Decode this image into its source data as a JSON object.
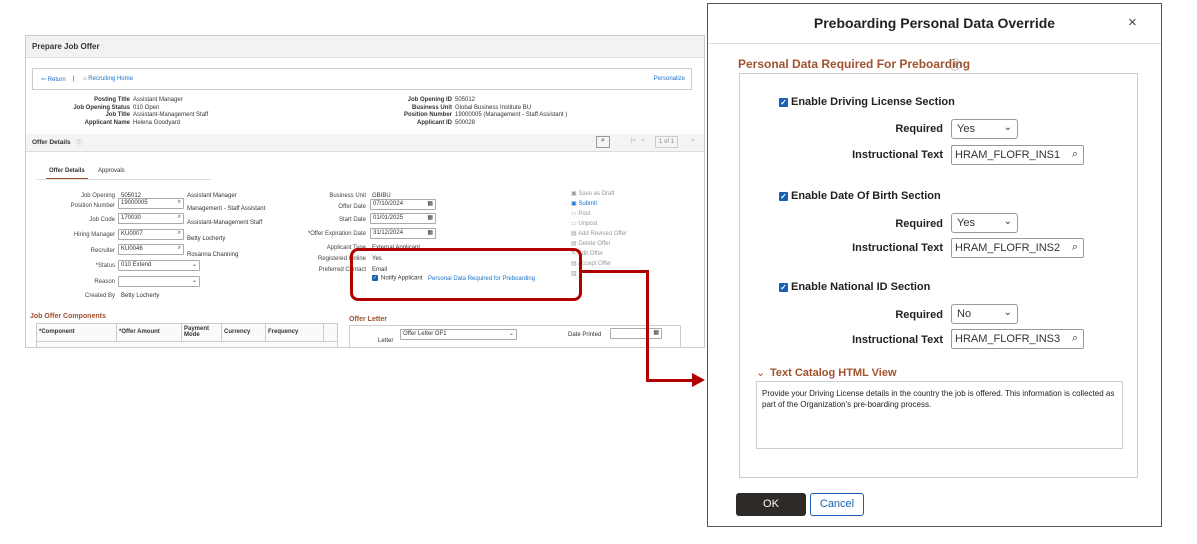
{
  "left": {
    "title": "Prepare Job Offer",
    "nav": {
      "return": "Return",
      "home": "Recruiting Home",
      "personalize": "Personalize"
    },
    "header": [
      {
        "label": "Posting Title",
        "value": "Assistant Manager"
      },
      {
        "label": "Job Opening Status",
        "value": "010 Open"
      },
      {
        "label": "Job Title",
        "value": "Assistant-Management Staff"
      },
      {
        "label": "Applicant Name",
        "value": "Helena Goodyard"
      }
    ],
    "header_right": [
      {
        "label": "Job Opening ID",
        "value": "505012"
      },
      {
        "label": "Business Unit",
        "value": "Global Business Institute BU"
      },
      {
        "label": "Position Number",
        "value": "19000005 (Management - Staff Assistant )"
      },
      {
        "label": "Applicant ID",
        "value": "500028"
      }
    ],
    "offer_details": "Offer Details",
    "pager": "1 of 1",
    "tabs": [
      "Offer Details",
      "Approvals"
    ],
    "form": {
      "job_opening": {
        "label": "Job Opening",
        "value": "505012",
        "desc": "Assistant Manager"
      },
      "position_number": {
        "label": "Position Number",
        "value": "19000005",
        "desc": "Management - Staff Assistant"
      },
      "job_code": {
        "label": "Job Code",
        "value": "170030",
        "desc": "Assistant-Management Staff"
      },
      "hiring_manager": {
        "label": "Hiring Manager",
        "value": "KU0007",
        "desc": "Betty Locherty"
      },
      "recruiter": {
        "label": "Recruiter",
        "value": "KU0046",
        "desc": "Rosanna Channing"
      },
      "status": {
        "label": "*Status",
        "value": "010 Extend"
      },
      "reason": {
        "label": "Reason",
        "value": ""
      },
      "created_by": {
        "label": "Created By",
        "value": "Betty Locherty"
      }
    },
    "form2": {
      "business_unit": {
        "label": "Business Unit",
        "value": "GBIBU"
      },
      "offer_date": {
        "label": "Offer Date",
        "value": "07/10/2024"
      },
      "start_date": {
        "label": "Start Date",
        "value": "01/01/2025"
      },
      "expiration": {
        "label": "*Offer Expiration Date",
        "value": "31/12/2024"
      },
      "applicant_type": {
        "label": "Applicant Type",
        "value": "External Applicant"
      },
      "registered": {
        "label": "Registered Online",
        "value": "Yes"
      },
      "contact": {
        "label": "Preferred Contact",
        "value": "Email"
      },
      "notify": "Notify Applicant",
      "preboarding_link": "Personal Data Required for Preboarding"
    },
    "actions": [
      "Save as Draft",
      "Submit",
      "Post",
      "Unpost",
      "Add Revised Offer",
      "Delete Offer",
      "Edit Offer",
      "Accept Offer"
    ],
    "components": {
      "title": "Job Offer Components",
      "columns": [
        "*Component",
        "*Offer Amount",
        "Payment Mode",
        "Currency",
        "Frequency"
      ]
    },
    "letter": {
      "title": "Offer Letter",
      "label": "Letter",
      "value": "Offer Letter OF1",
      "date_printed": "Date Printed"
    }
  },
  "dialog": {
    "title": "Preboarding Personal Data Override",
    "section": "Personal Data Required For Preboarding",
    "groups": [
      {
        "enable": "Enable Driving License Section",
        "required_label": "Required",
        "required": "Yes",
        "text_label": "Instructional Text",
        "text": "HRAM_FLOFR_INS1"
      },
      {
        "enable": "Enable Date Of Birth Section",
        "required_label": "Required",
        "required": "Yes",
        "text_label": "Instructional Text",
        "text": "HRAM_FLOFR_INS2"
      },
      {
        "enable": "Enable National ID Section",
        "required_label": "Required",
        "required": "No",
        "text_label": "Instructional Text",
        "text": "HRAM_FLOFR_INS3"
      }
    ],
    "catalog_title": "Text Catalog HTML View",
    "catalog_text": "Provide your Driving License details in the country the job is offered. This information is collected as part of the Organization's pre-boarding process.",
    "ok": "OK",
    "cancel": "Cancel"
  },
  "colors": {
    "accent": "#a0522d",
    "highlight": "#b00000",
    "ok_bg": "#2e2a27"
  }
}
